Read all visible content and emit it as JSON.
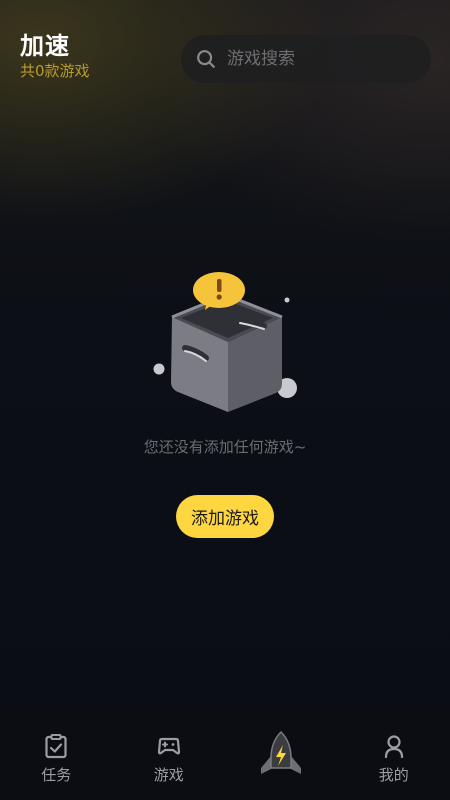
{
  "header": {
    "title": "加速",
    "subtitle": "共0款游戏"
  },
  "search": {
    "placeholder": "游戏搜索",
    "value": ""
  },
  "empty_state": {
    "message": "您还没有添加任何游戏~",
    "button_label": "添加游戏",
    "illustration_icon": "empty-box-icon"
  },
  "bottom_nav": {
    "items": [
      {
        "label": "任务",
        "icon": "task-clipboard-icon"
      },
      {
        "label": "游戏",
        "icon": "gamepad-icon"
      },
      {
        "label": "",
        "icon": "rocket-boost-icon"
      },
      {
        "label": "我的",
        "icon": "profile-icon"
      }
    ]
  },
  "colors": {
    "accent_yellow": "#fdd640",
    "subtitle_gold": "#b89a2e",
    "background": "#0a0d14",
    "nav_text": "#9b9da3"
  }
}
